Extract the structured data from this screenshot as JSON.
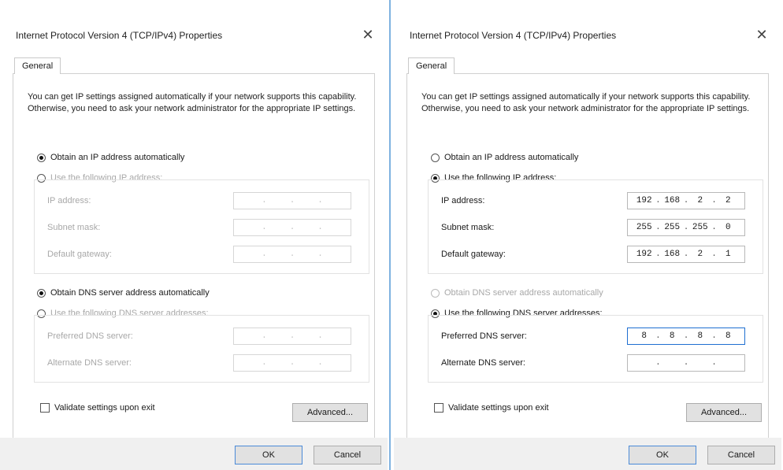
{
  "dialogs": {
    "left": {
      "title": "Internet Protocol Version 4 (TCP/IPv4) Properties",
      "tab": "General",
      "description": "You can get IP settings assigned automatically if your network supports this capability. Otherwise, you need to ask your network administrator for the appropriate IP settings.",
      "ip_auto_label": "Obtain an IP address automatically",
      "ip_manual_label": "Use the following IP address:",
      "ip_address_label": "IP address:",
      "subnet_label": "Subnet mask:",
      "gateway_label": "Default gateway:",
      "ip_address": [
        "",
        "",
        "",
        ""
      ],
      "subnet": [
        "",
        "",
        "",
        ""
      ],
      "gateway": [
        "",
        "",
        "",
        ""
      ],
      "dns_auto_label": "Obtain DNS server address automatically",
      "dns_manual_label": "Use the following DNS server addresses:",
      "preferred_dns_label": "Preferred DNS server:",
      "alternate_dns_label": "Alternate DNS server:",
      "preferred_dns": [
        "",
        "",
        "",
        ""
      ],
      "alternate_dns": [
        "",
        "",
        "",
        ""
      ],
      "validate_label": "Validate settings upon exit",
      "advanced_label": "Advanced...",
      "ok_label": "OK",
      "cancel_label": "Cancel"
    },
    "right": {
      "title": "Internet Protocol Version 4 (TCP/IPv4) Properties",
      "tab": "General",
      "description": "You can get IP settings assigned automatically if your network supports this capability. Otherwise, you need to ask your network administrator for the appropriate IP settings.",
      "ip_auto_label": "Obtain an IP address automatically",
      "ip_manual_label": "Use the following IP address:",
      "ip_address_label": "IP address:",
      "subnet_label": "Subnet mask:",
      "gateway_label": "Default gateway:",
      "ip_address": [
        "192",
        "168",
        "2",
        "2"
      ],
      "subnet": [
        "255",
        "255",
        "255",
        "0"
      ],
      "gateway": [
        "192",
        "168",
        "2",
        "1"
      ],
      "dns_auto_label": "Obtain DNS server address automatically",
      "dns_manual_label": "Use the following DNS server addresses:",
      "preferred_dns_label": "Preferred DNS server:",
      "alternate_dns_label": "Alternate DNS server:",
      "preferred_dns": [
        "8",
        "8",
        "8",
        "8"
      ],
      "alternate_dns": [
        "",
        "",
        "",
        ""
      ],
      "validate_label": "Validate settings upon exit",
      "advanced_label": "Advanced...",
      "ok_label": "OK",
      "cancel_label": "Cancel"
    }
  },
  "icons": {
    "close": "close-icon"
  },
  "colors": {
    "focus_border": "#1f6fd1",
    "ok_border": "#4a8ad8",
    "divider": "#7fb2e0"
  }
}
